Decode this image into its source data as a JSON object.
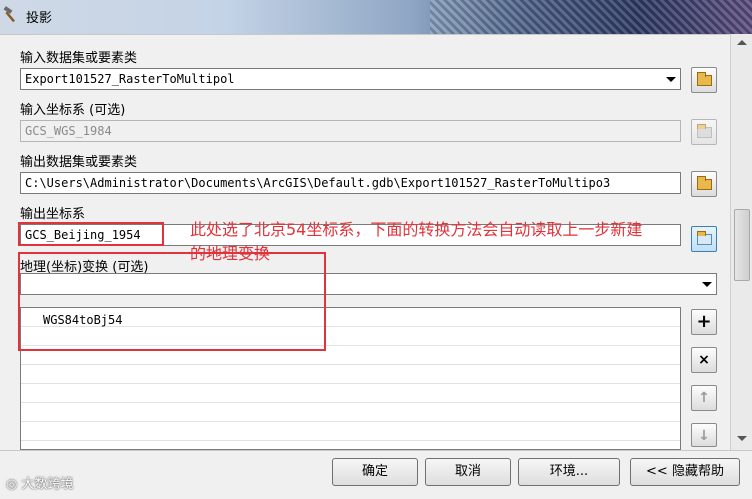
{
  "window": {
    "title": "投影"
  },
  "input_dataset": {
    "label": "输入数据集或要素类",
    "value": "Export101527_RasterToMultipol"
  },
  "input_crs": {
    "label": "输入坐标系 (可选)",
    "value": "GCS_WGS_1984"
  },
  "output_dataset": {
    "label": "输出数据集或要素类",
    "value": "C:\\Users\\Administrator\\Documents\\ArcGIS\\Default.gdb\\Export101527_RasterToMultipo3"
  },
  "output_crs": {
    "label": "输出坐标系",
    "value": "GCS_Beijing_1954"
  },
  "transformation": {
    "label": "地理(坐标)变换 (可选)",
    "dropdown_value": "",
    "items": [
      "WGS84toBj54"
    ]
  },
  "annotation": {
    "line1": "此处选了北京54坐标系，下面的转换方法会自动读取上一步新建",
    "line2": "的地理变换",
    "color": "#e0333b"
  },
  "side_buttons": {
    "add": "+",
    "remove": "×",
    "up": "↑",
    "down": "↓"
  },
  "buttons": {
    "ok": "确定",
    "cancel": "取消",
    "environments": "环境...",
    "hide_help": "<< 隐藏帮助"
  },
  "watermark": "大数跨境"
}
